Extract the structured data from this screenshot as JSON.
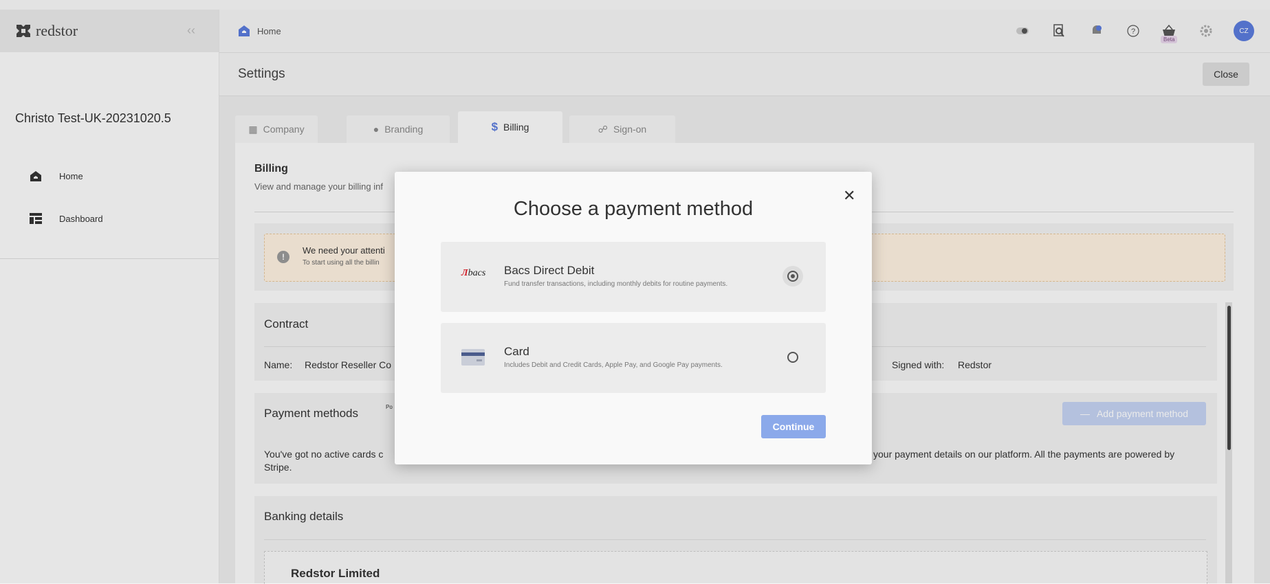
{
  "app": {
    "logo_text": "redstor",
    "collapse_icon": "chevron-left-icon"
  },
  "sidebar": {
    "org_name": "Christo Test-UK-20231020.5",
    "items": [
      {
        "label": "Home",
        "icon": "home-icon"
      },
      {
        "label": "Dashboard",
        "icon": "dashboard-icon"
      }
    ]
  },
  "header": {
    "breadcrumb": "Home",
    "beta_label": "Beta",
    "avatar_initials": "CZ"
  },
  "settings": {
    "title": "Settings",
    "close_label": "Close"
  },
  "tabs": [
    {
      "label": "Company",
      "icon": "building-icon"
    },
    {
      "label": "Branding",
      "icon": "palette-icon"
    },
    {
      "label": "Billing",
      "icon": "dollar-icon"
    },
    {
      "label": "Sign-on",
      "icon": "key-icon"
    }
  ],
  "billing": {
    "title": "Billing",
    "subtitle": "View and manage your billing inf",
    "attention_title": "We need your attenti",
    "attention_sub": "To start using all the billin",
    "contract_title": "Contract",
    "name_label": "Name:",
    "name_value": "Redstor Reseller Co",
    "signed_label": "Signed with:",
    "signed_value": "Redstor",
    "payment_title": "Payment methods",
    "payment_small": "Po",
    "add_payment_label": "Add payment method",
    "payment_text_left": "You've got no active cards c",
    "payment_text_right": "your payment details on our platform. All the payments are powered by",
    "payment_text_stripe": "Stripe.",
    "banking_title": "Banking details",
    "bank_name": "Redstor Limited"
  },
  "modal": {
    "title": "Choose a payment method",
    "continue_label": "Continue",
    "options": [
      {
        "name": "Bacs Direct Debit",
        "desc": "Fund transfer transactions, including monthly debits for routine payments.",
        "logo_text": "bacs",
        "selected": true
      },
      {
        "name": "Card",
        "desc": "Includes Debit and Credit Cards, Apple Pay, and Google Pay payments.",
        "selected": false
      }
    ]
  },
  "colors": {
    "accent": "#5b7bdc",
    "continue": "#8ba9ea",
    "bacs_red": "#d1222b"
  }
}
